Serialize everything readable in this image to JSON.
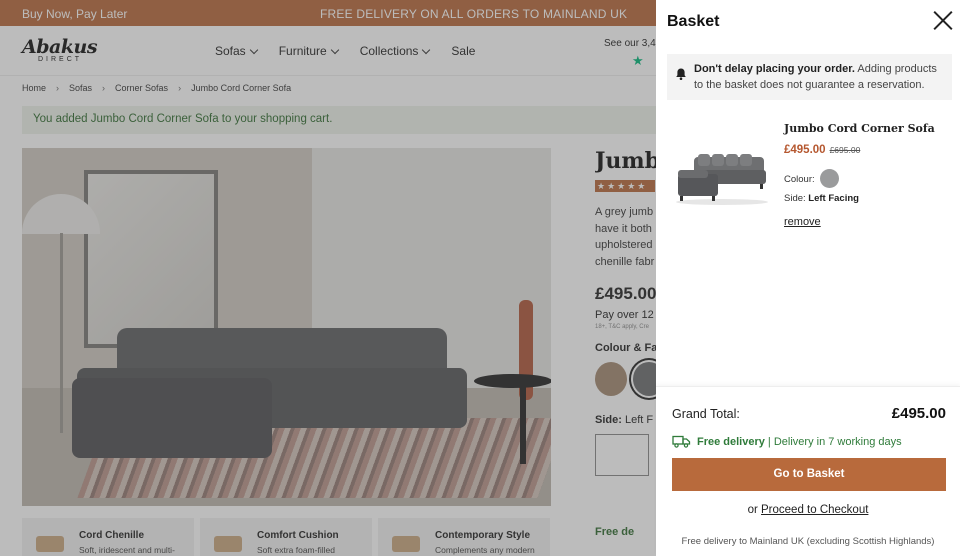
{
  "promo": {
    "left": "Buy Now, Pay Later",
    "center": "FREE DELIVERY ON ALL ORDERS TO MAINLAND UK"
  },
  "header": {
    "logo_text": "Abakus",
    "logo_sub": "DIRECT",
    "nav": [
      "Sofas",
      "Furniture",
      "Collections",
      "Sale"
    ],
    "see_our": "See our 3,40"
  },
  "breadcrumb": [
    "Home",
    "Sofas",
    "Corner Sofas",
    "Jumbo Cord Corner Sofa"
  ],
  "added_message": "You added Jumbo Cord Corner Sofa to your shopping cart.",
  "product": {
    "title": "Jumbo",
    "description_lines": [
      "A grey jumb",
      "have it both",
      "upholstered",
      "chenille fabr"
    ],
    "price": "£495.00",
    "pay_over": "Pay over 12 m",
    "pay_small": "18+, T&C apply, Cre",
    "colour_label": "Colour & Fa",
    "side_label": "Side:",
    "side_value": "Left F",
    "free_delivery": "Free de"
  },
  "features": [
    {
      "title": "Cord Chenille",
      "text": "Soft, iridescent and multi-"
    },
    {
      "title": "Comfort Cushion",
      "text": "Soft extra foam-filled"
    },
    {
      "title": "Contemporary Style",
      "text": "Complements any modern"
    }
  ],
  "basket": {
    "title": "Basket",
    "notice_bold": "Don't delay placing your order.",
    "notice_rest": " Adding products to the basket does not guarantee a reservation.",
    "item": {
      "name": "Jumbo Cord Corner Sofa",
      "price": "£495.00",
      "old_price": "£695.00",
      "colour_label": "Colour:",
      "side_label": "Side:",
      "side_value": "Left Facing",
      "remove": "remove"
    },
    "grand_total_label": "Grand Total:",
    "grand_total_value": "£495.00",
    "delivery_bold": "Free delivery",
    "delivery_sep": " | ",
    "delivery_rest": "Delivery in 7 working days",
    "go_button": "Go to Basket",
    "or": "or",
    "checkout_link": "Proceed to Checkout",
    "footnote": "Free delivery to Mainland UK (excluding Scottish Highlands)"
  },
  "colors": {
    "brand": "#b86a3c",
    "success": "#2f7b3a",
    "price": "#b5572f"
  }
}
